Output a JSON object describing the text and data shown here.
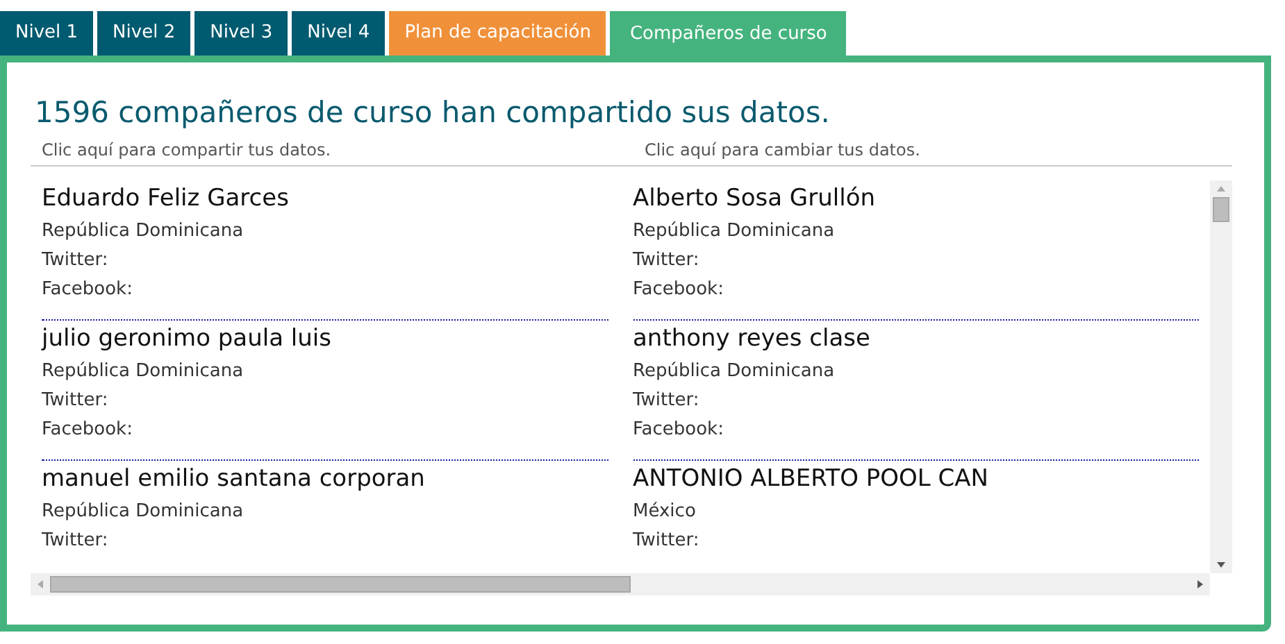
{
  "tabs": [
    {
      "label": "Nivel 1",
      "selected": false,
      "color": "#005a70"
    },
    {
      "label": "Nivel 2",
      "selected": false,
      "color": "#005a70"
    },
    {
      "label": "Nivel 3",
      "selected": false,
      "color": "#005a70"
    },
    {
      "label": "Nivel 4",
      "selected": false,
      "color": "#005a70"
    },
    {
      "label": "Plan de capacitación",
      "selected": false,
      "color": "#f0913a"
    },
    {
      "label": "Compañeros de curso",
      "selected": true,
      "color": "#45b37e"
    }
  ],
  "heading": "1596 compañeros de curso han compartido sus datos.",
  "links": [
    "Clic aquí para compartir tus datos.",
    "Clic aquí para cambiar tus datos."
  ],
  "classmates": [
    {
      "name": "Eduardo Feliz Garces",
      "country": "República Dominicana",
      "twitter": "Twitter:",
      "facebook": "Facebook:"
    },
    {
      "name": "Alberto Sosa Grullón",
      "country": "República Dominicana",
      "twitter": "Twitter:",
      "facebook": "Facebook:"
    },
    {
      "name": "julio geronimo paula luis",
      "country": "República Dominicana",
      "twitter": "Twitter:",
      "facebook": "Facebook:"
    },
    {
      "name": "anthony reyes clase",
      "country": "República Dominicana",
      "twitter": "Twitter:",
      "facebook": "Facebook:"
    },
    {
      "name": "manuel emilio santana corporan",
      "country": "República Dominicana",
      "twitter": "Twitter:"
    },
    {
      "name": "ANTONIO ALBERTO POOL CAN",
      "country": "México",
      "twitter": "Twitter:"
    }
  ]
}
